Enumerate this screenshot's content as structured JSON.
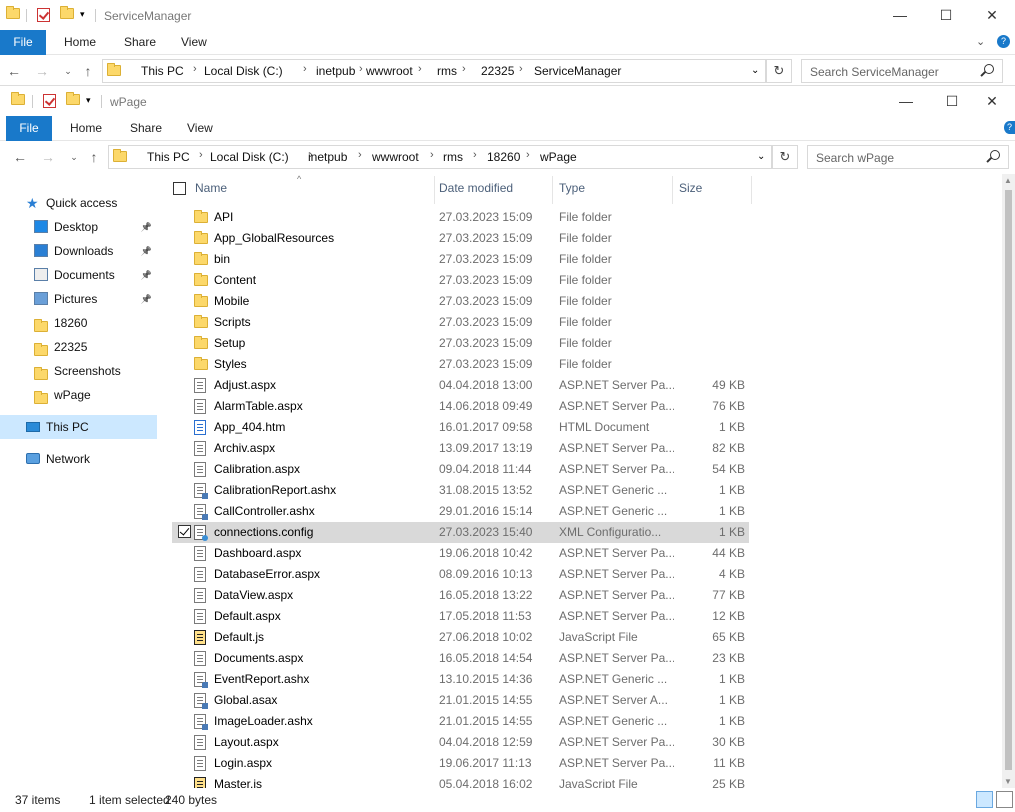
{
  "back_window": {
    "title": "ServiceManager",
    "tabs": [
      "File",
      "Home",
      "Share",
      "View"
    ],
    "breadcrumb": [
      "This PC",
      "Local Disk (C:)",
      "inetpub",
      "wwwroot",
      "rms",
      "22325",
      "ServiceManager"
    ],
    "search_placeholder": "Search ServiceManager"
  },
  "front_window": {
    "title": "wPage",
    "tabs": [
      "File",
      "Home",
      "Share",
      "View"
    ],
    "breadcrumb": [
      "This PC",
      "Local Disk (C:)",
      "inetpub",
      "wwwroot",
      "rms",
      "18260",
      "wPage"
    ],
    "search_placeholder": "Search wPage"
  },
  "window_controls": {
    "minimize": "—",
    "maximize": "☐",
    "close": "✕"
  },
  "nav_pane": {
    "quick_access": "Quick access",
    "items": [
      {
        "label": "Desktop",
        "icon": "desktop-icon",
        "pinned": true
      },
      {
        "label": "Downloads",
        "icon": "downloads-icon",
        "pinned": true
      },
      {
        "label": "Documents",
        "icon": "documents-icon",
        "pinned": true
      },
      {
        "label": "Pictures",
        "icon": "pictures-icon",
        "pinned": true
      },
      {
        "label": "18260",
        "icon": "folder-icon",
        "pinned": false
      },
      {
        "label": "22325",
        "icon": "folder-icon",
        "pinned": false
      },
      {
        "label": "Screenshots",
        "icon": "folder-icon",
        "pinned": false
      },
      {
        "label": "wPage",
        "icon": "folder-icon",
        "pinned": false
      }
    ],
    "this_pc": "This PC",
    "network": "Network"
  },
  "columns": {
    "name": "Name",
    "date": "Date modified",
    "type": "Type",
    "size": "Size"
  },
  "files": [
    {
      "name": "API",
      "date": "27.03.2023 15:09",
      "type": "File folder",
      "size": "",
      "icon": "folder"
    },
    {
      "name": "App_GlobalResources",
      "date": "27.03.2023 15:09",
      "type": "File folder",
      "size": "",
      "icon": "folder"
    },
    {
      "name": "bin",
      "date": "27.03.2023 15:09",
      "type": "File folder",
      "size": "",
      "icon": "folder"
    },
    {
      "name": "Content",
      "date": "27.03.2023 15:09",
      "type": "File folder",
      "size": "",
      "icon": "folder"
    },
    {
      "name": "Mobile",
      "date": "27.03.2023 15:09",
      "type": "File folder",
      "size": "",
      "icon": "folder"
    },
    {
      "name": "Scripts",
      "date": "27.03.2023 15:09",
      "type": "File folder",
      "size": "",
      "icon": "folder"
    },
    {
      "name": "Setup",
      "date": "27.03.2023 15:09",
      "type": "File folder",
      "size": "",
      "icon": "folder"
    },
    {
      "name": "Styles",
      "date": "27.03.2023 15:09",
      "type": "File folder",
      "size": "",
      "icon": "folder"
    },
    {
      "name": "Adjust.aspx",
      "date": "04.04.2018 13:00",
      "type": "ASP.NET Server Pa...",
      "size": "49 KB",
      "icon": "doc"
    },
    {
      "name": "AlarmTable.aspx",
      "date": "14.06.2018 09:49",
      "type": "ASP.NET Server Pa...",
      "size": "76 KB",
      "icon": "doc"
    },
    {
      "name": "App_404.htm",
      "date": "16.01.2017 09:58",
      "type": "HTML Document",
      "size": "1 KB",
      "icon": "html"
    },
    {
      "name": "Archiv.aspx",
      "date": "13.09.2017 13:19",
      "type": "ASP.NET Server Pa...",
      "size": "82 KB",
      "icon": "doc"
    },
    {
      "name": "Calibration.aspx",
      "date": "09.04.2018 11:44",
      "type": "ASP.NET Server Pa...",
      "size": "54 KB",
      "icon": "doc"
    },
    {
      "name": "CalibrationReport.ashx",
      "date": "31.08.2015 13:52",
      "type": "ASP.NET Generic ...",
      "size": "1 KB",
      "icon": "gen"
    },
    {
      "name": "CallController.ashx",
      "date": "29.01.2016 15:14",
      "type": "ASP.NET Generic ...",
      "size": "1 KB",
      "icon": "gen"
    },
    {
      "name": "connections.config",
      "date": "27.03.2023 15:40",
      "type": "XML Configuratio...",
      "size": "1 KB",
      "icon": "cfg",
      "selected": true
    },
    {
      "name": "Dashboard.aspx",
      "date": "19.06.2018 10:42",
      "type": "ASP.NET Server Pa...",
      "size": "44 KB",
      "icon": "doc"
    },
    {
      "name": "DatabaseError.aspx",
      "date": "08.09.2016 10:13",
      "type": "ASP.NET Server Pa...",
      "size": "4 KB",
      "icon": "doc"
    },
    {
      "name": "DataView.aspx",
      "date": "16.05.2018 13:22",
      "type": "ASP.NET Server Pa...",
      "size": "77 KB",
      "icon": "doc"
    },
    {
      "name": "Default.aspx",
      "date": "17.05.2018 11:53",
      "type": "ASP.NET Server Pa...",
      "size": "12 KB",
      "icon": "doc"
    },
    {
      "name": "Default.js",
      "date": "27.06.2018 10:02",
      "type": "JavaScript File",
      "size": "65 KB",
      "icon": "js"
    },
    {
      "name": "Documents.aspx",
      "date": "16.05.2018 14:54",
      "type": "ASP.NET Server Pa...",
      "size": "23 KB",
      "icon": "doc"
    },
    {
      "name": "EventReport.ashx",
      "date": "13.10.2015 14:36",
      "type": "ASP.NET Generic ...",
      "size": "1 KB",
      "icon": "gen"
    },
    {
      "name": "Global.asax",
      "date": "21.01.2015 14:55",
      "type": "ASP.NET Server A...",
      "size": "1 KB",
      "icon": "gen"
    },
    {
      "name": "ImageLoader.ashx",
      "date": "21.01.2015 14:55",
      "type": "ASP.NET Generic ...",
      "size": "1 KB",
      "icon": "gen"
    },
    {
      "name": "Layout.aspx",
      "date": "04.04.2018 12:59",
      "type": "ASP.NET Server Pa...",
      "size": "30 KB",
      "icon": "doc"
    },
    {
      "name": "Login.aspx",
      "date": "19.06.2017 11:13",
      "type": "ASP.NET Server Pa...",
      "size": "11 KB",
      "icon": "doc"
    },
    {
      "name": "Master.js",
      "date": "05.04.2018 16:02",
      "type": "JavaScript File",
      "size": "25 KB",
      "icon": "js"
    }
  ],
  "status": {
    "count": "37 items",
    "selection": "1 item selected",
    "size": "240 bytes"
  },
  "colors": {
    "accent": "#1979ca",
    "folder": "#fcd86a",
    "selected_nav": "#cce8ff",
    "selected_row": "#d9d9d9"
  }
}
